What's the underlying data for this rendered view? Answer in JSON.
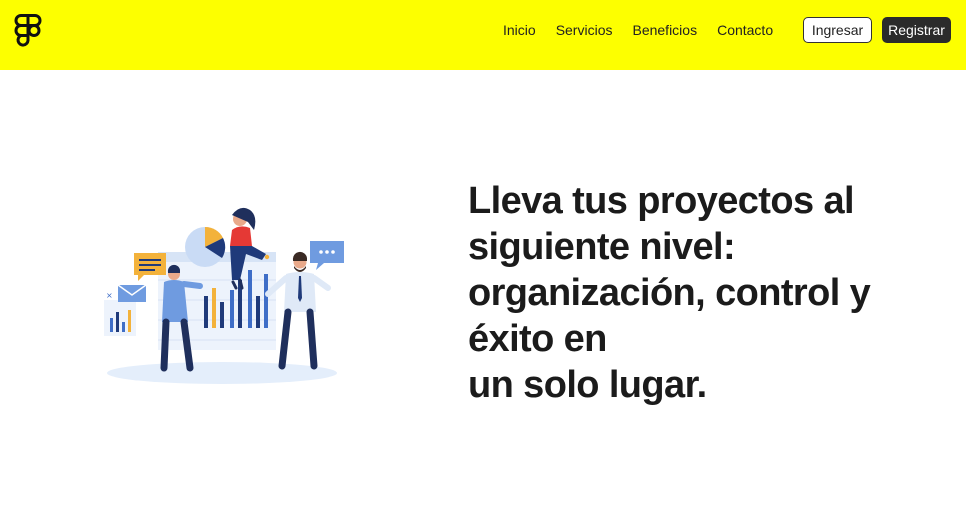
{
  "nav": {
    "links": [
      "Inicio",
      "Servicios",
      "Beneficios",
      "Contacto"
    ],
    "login_label": "Ingresar",
    "register_label": "Registrar"
  },
  "hero": {
    "title_lines": [
      "Lleva tus proyectos al",
      "siguiente nivel:",
      "organización, control y",
      "éxito en",
      "un solo lugar."
    ]
  },
  "icons": {
    "logo": "figma-logo-icon",
    "illustration": "team-analytics-illustration"
  },
  "colors": {
    "navbar_bg": "#fdff00",
    "register_bg": "#2b2b2b",
    "text": "#1b1b1b"
  }
}
